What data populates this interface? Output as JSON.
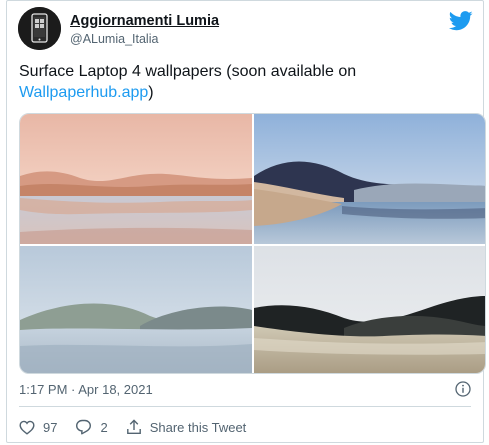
{
  "author": {
    "display_name": "Aggiornamenti Lumia",
    "handle": "@ALumia_Italia"
  },
  "tweet": {
    "text": "Surface Laptop 4 wallpapers (soon available on ",
    "link_text": "Wallpaperhub.app",
    "text_end": ")",
    "timestamp": "1:17 PM · Apr 18, 2021"
  },
  "media": [
    {
      "description": "pink-desert-lake-wallpaper"
    },
    {
      "description": "blue-dunes-lake-wallpaper"
    },
    {
      "description": "misty-hills-wallpaper"
    },
    {
      "description": "dark-hills-meadow-wallpaper"
    }
  ],
  "actions": {
    "like_count": "97",
    "reply_count": "2",
    "share_label": "Share this Tweet"
  },
  "colors": {
    "link": "#1d9bf0",
    "text": "#0f1419",
    "muted": "#536471"
  }
}
